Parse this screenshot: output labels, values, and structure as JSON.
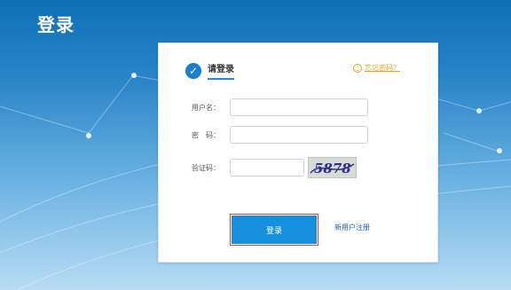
{
  "page": {
    "title": "登录"
  },
  "login_card": {
    "tab_label": "请登录",
    "forgot_password": "忘记密码？",
    "fields": {
      "username": {
        "label": "用户名：",
        "value": ""
      },
      "password": {
        "label": "密　码：",
        "value": ""
      },
      "captcha": {
        "label": "验证码：",
        "value": "",
        "image_text": "5878"
      }
    },
    "login_button": "登录",
    "register_link": "新用户注册"
  },
  "colors": {
    "accent": "#1690dc",
    "highlight": "#e03e3e",
    "link": "#e6a325"
  }
}
